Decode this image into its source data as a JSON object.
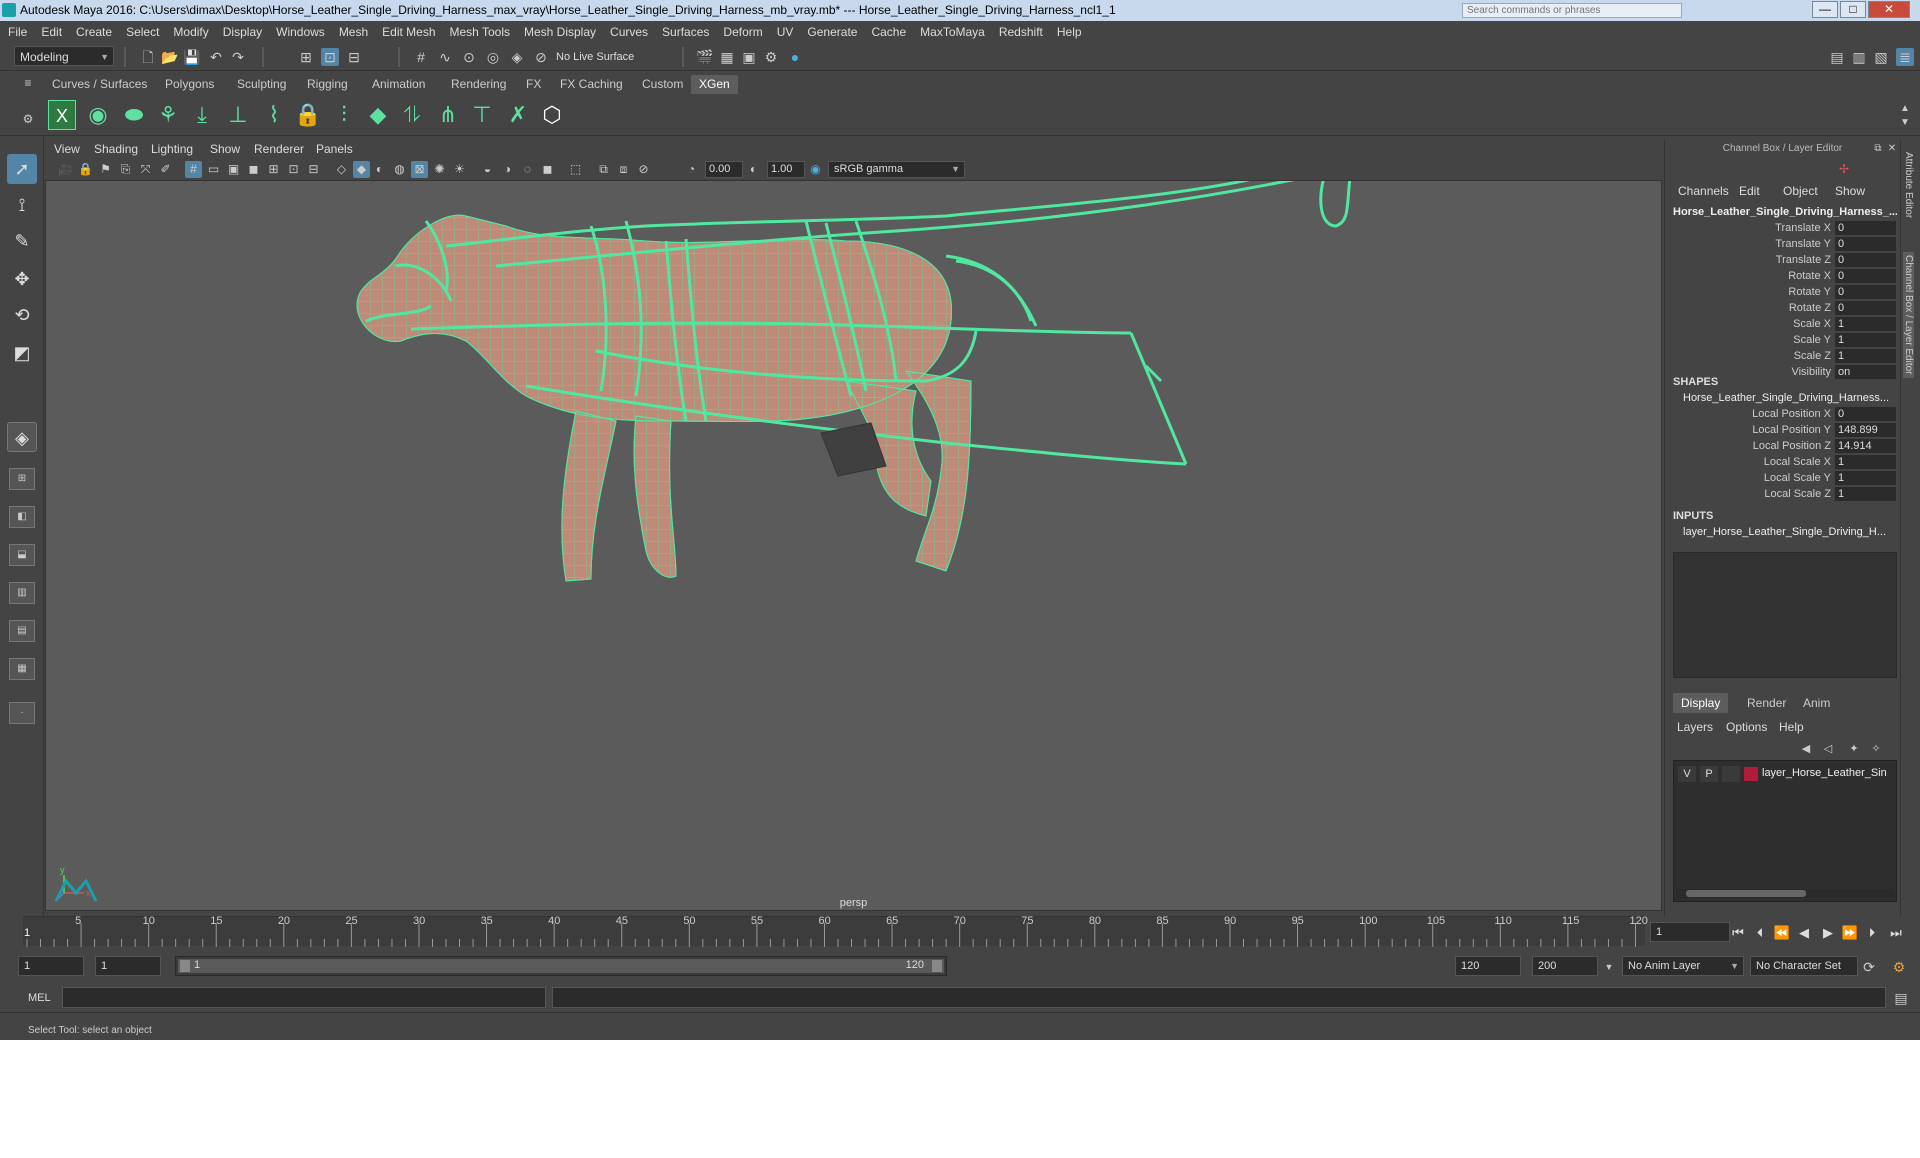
{
  "window": {
    "title": "Autodesk Maya 2016: C:\\Users\\dimax\\Desktop\\Horse_Leather_Single_Driving_Harness_max_vray\\Horse_Leather_Single_Driving_Harness_mb_vray.mb*   ---   Horse_Leather_Single_Driving_Harness_ncl1_1",
    "search_placeholder": "Search commands or phrases",
    "minimize": "—",
    "maximize": "□",
    "close": "✕"
  },
  "menu": [
    "File",
    "Edit",
    "Create",
    "Select",
    "Modify",
    "Display",
    "Windows",
    "Mesh",
    "Edit Mesh",
    "Mesh Tools",
    "Mesh Display",
    "Curves",
    "Surfaces",
    "Deform",
    "UV",
    "Generate",
    "Cache",
    "MaxToMaya",
    "Redshift",
    "Help"
  ],
  "statusline": {
    "mode": "Modeling",
    "live_surface": "No Live Surface"
  },
  "shelf_tabs": [
    "Curves / Surfaces",
    "Polygons",
    "Sculpting",
    "Rigging",
    "Animation",
    "Rendering",
    "FX",
    "FX Caching",
    "Custom",
    "XGen"
  ],
  "active_shelf": "XGen",
  "viewport": {
    "menu": [
      "View",
      "Shading",
      "Lighting",
      "Show",
      "Renderer",
      "Panels"
    ],
    "exposure": "0.00",
    "gamma": "1.00",
    "colorspace": "sRGB gamma",
    "camera": "persp",
    "wire_color": "#50e8a0",
    "skin_color": "#c08a78"
  },
  "channelbox": {
    "title": "Channel Box / Layer Editor",
    "menu": [
      "Channels",
      "Edit",
      "Object",
      "Show"
    ],
    "object": "Horse_Leather_Single_Driving_Harness_...",
    "attributes": [
      {
        "name": "Translate X",
        "value": "0"
      },
      {
        "name": "Translate Y",
        "value": "0"
      },
      {
        "name": "Translate Z",
        "value": "0"
      },
      {
        "name": "Rotate X",
        "value": "0"
      },
      {
        "name": "Rotate Y",
        "value": "0"
      },
      {
        "name": "Rotate Z",
        "value": "0"
      },
      {
        "name": "Scale X",
        "value": "1"
      },
      {
        "name": "Scale Y",
        "value": "1"
      },
      {
        "name": "Scale Z",
        "value": "1"
      },
      {
        "name": "Visibility",
        "value": "on"
      }
    ],
    "shapes_label": "SHAPES",
    "shape_name": "Horse_Leather_Single_Driving_Harness...",
    "shape_attributes": [
      {
        "name": "Local Position X",
        "value": "0"
      },
      {
        "name": "Local Position Y",
        "value": "148.899"
      },
      {
        "name": "Local Position Z",
        "value": "14.914"
      },
      {
        "name": "Local Scale X",
        "value": "1"
      },
      {
        "name": "Local Scale Y",
        "value": "1"
      },
      {
        "name": "Local Scale Z",
        "value": "1"
      }
    ],
    "inputs_label": "INPUTS",
    "input_name": "layer_Horse_Leather_Single_Driving_H..."
  },
  "layer_editor": {
    "tabs": [
      "Display",
      "Render",
      "Anim"
    ],
    "active_tab": "Display",
    "menu": [
      "Layers",
      "Options",
      "Help"
    ],
    "layer": {
      "v": "V",
      "p": "P",
      "name": "layer_Horse_Leather_Sin",
      "color": "#b01c3c"
    }
  },
  "side_tabs": [
    "Attribute Editor",
    "Channel Box / Layer Editor"
  ],
  "timeslider": {
    "ticks": [
      "5",
      "10",
      "15",
      "20",
      "25",
      "30",
      "35",
      "40",
      "45",
      "50",
      "55",
      "60",
      "65",
      "70",
      "75",
      "80",
      "85",
      "90",
      "95",
      "100",
      "105",
      "110",
      "115",
      "120"
    ],
    "current": "1",
    "current_field": "1"
  },
  "range": {
    "start": "1",
    "playback_start": "1",
    "slider_start": "1",
    "slider_end": "120",
    "playback_end": "120",
    "end": "200",
    "anim_layer": "No Anim Layer",
    "char_set": "No Character Set"
  },
  "cmd": {
    "label": "MEL",
    "help": "Select Tool: select an object"
  }
}
